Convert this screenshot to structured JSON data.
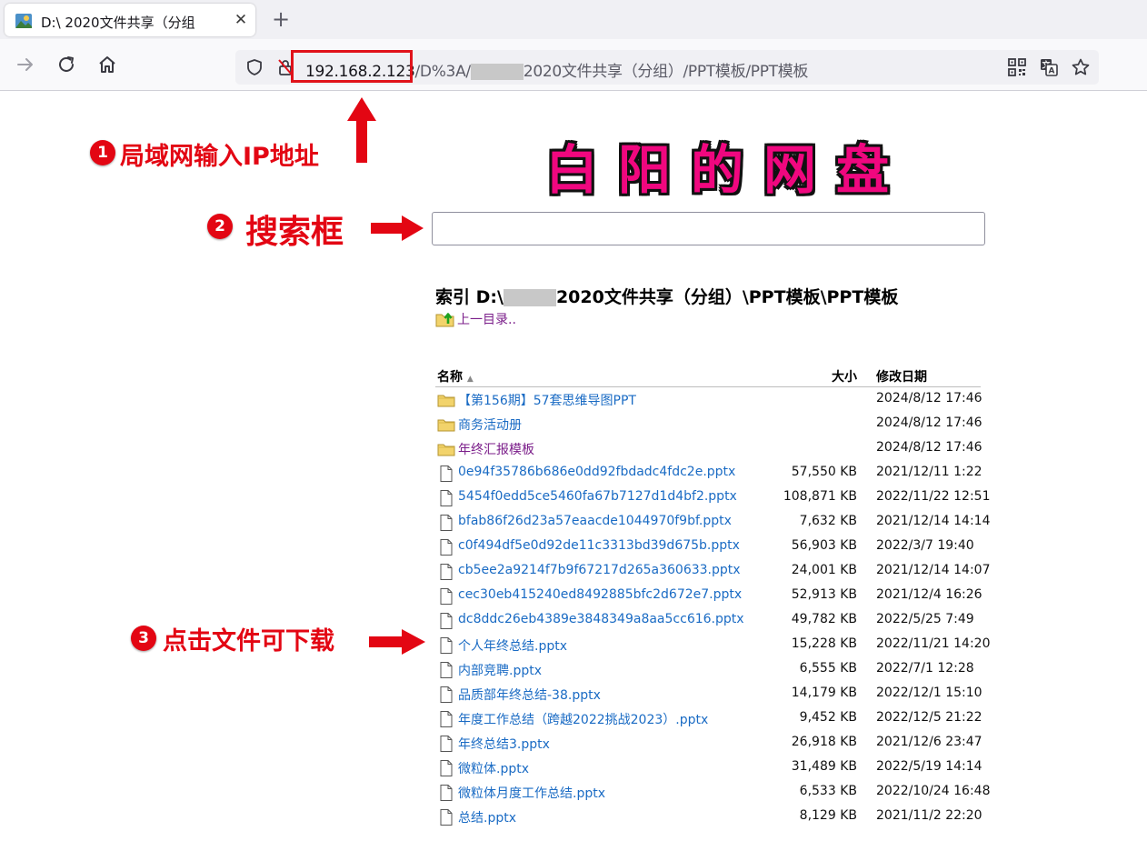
{
  "tab": {
    "title": "D:\\        2020文件共享（分组",
    "close": "✕",
    "new": "+"
  },
  "url": {
    "host": "192.168.2.123",
    "path_a": "/D%3A/",
    "path_b": "2020文件共享（分组）/PPT模板/PPT模板"
  },
  "annotations": {
    "a1": {
      "num": "1",
      "text": "局域网输入IP地址"
    },
    "a2": {
      "num": "2",
      "text": "搜索框"
    },
    "a3": {
      "num": "3",
      "text": "点击文件可下载"
    }
  },
  "page": {
    "banner": "白阳的网盘",
    "search_value": "",
    "index_title_a": "索引 D:\\",
    "index_title_b": "2020文件共享（分组）\\PPT模板\\PPT模板",
    "up_link": "上一目录..",
    "columns": {
      "name": "名称",
      "sort_indicator": "▲",
      "size": "大小",
      "date": "修改日期"
    }
  },
  "files": [
    {
      "name": "【第156期】57套思维导图PPT",
      "size": "",
      "date": "2024/8/12 17:46",
      "type": "folder",
      "visited": false
    },
    {
      "name": "商务活动册",
      "size": "",
      "date": "2024/8/12 17:46",
      "type": "folder",
      "visited": false
    },
    {
      "name": "年终汇报模板",
      "size": "",
      "date": "2024/8/12 17:46",
      "type": "folder",
      "visited": true
    },
    {
      "name": "0e94f35786b686e0dd92fbdadc4fdc2e.pptx",
      "size": "57,550 KB",
      "date": "2021/12/11 1:22",
      "type": "file"
    },
    {
      "name": "5454f0edd5ce5460fa67b7127d1d4bf2.pptx",
      "size": "108,871 KB",
      "date": "2022/11/22 12:51",
      "type": "file"
    },
    {
      "name": "bfab86f26d23a57eaacde1044970f9bf.pptx",
      "size": "7,632 KB",
      "date": "2021/12/14 14:14",
      "type": "file"
    },
    {
      "name": "c0f494df5e0d92de11c3313bd39d675b.pptx",
      "size": "56,903 KB",
      "date": "2022/3/7 19:40",
      "type": "file"
    },
    {
      "name": "cb5ee2a9214f7b9f67217d265a360633.pptx",
      "size": "24,001 KB",
      "date": "2021/12/14 14:07",
      "type": "file"
    },
    {
      "name": "cec30eb415240ed8492885bfc2d672e7.pptx",
      "size": "52,913 KB",
      "date": "2021/12/4 16:26",
      "type": "file"
    },
    {
      "name": "dc8ddc26eb4389e3848349a8aa5cc616.pptx",
      "size": "49,782 KB",
      "date": "2022/5/25 7:49",
      "type": "file"
    },
    {
      "name": "个人年终总结.pptx",
      "size": "15,228 KB",
      "date": "2022/11/21 14:20",
      "type": "file"
    },
    {
      "name": "内部竞聘.pptx",
      "size": "6,555 KB",
      "date": "2022/7/1 12:28",
      "type": "file"
    },
    {
      "name": "品质部年终总结-38.pptx",
      "size": "14,179 KB",
      "date": "2022/12/1 15:10",
      "type": "file"
    },
    {
      "name": "年度工作总结（跨越2022挑战2023）.pptx",
      "size": "9,452 KB",
      "date": "2022/12/5 21:22",
      "type": "file"
    },
    {
      "name": "年终总结3.pptx",
      "size": "26,918 KB",
      "date": "2021/12/6 23:47",
      "type": "file"
    },
    {
      "name": "微粒体.pptx",
      "size": "31,489 KB",
      "date": "2022/5/19 14:14",
      "type": "file"
    },
    {
      "name": "微粒体月度工作总结.pptx",
      "size": "6,533 KB",
      "date": "2022/10/24 16:48",
      "type": "file"
    },
    {
      "name": "总结.pptx",
      "size": "8,129 KB",
      "date": "2021/11/2 22:20",
      "type": "file"
    }
  ],
  "colors": {
    "annotation_red": "#e30613",
    "banner_pink": "#f0077f",
    "link_blue": "#1a6bc4",
    "visited_purple": "#7b1e8a"
  }
}
